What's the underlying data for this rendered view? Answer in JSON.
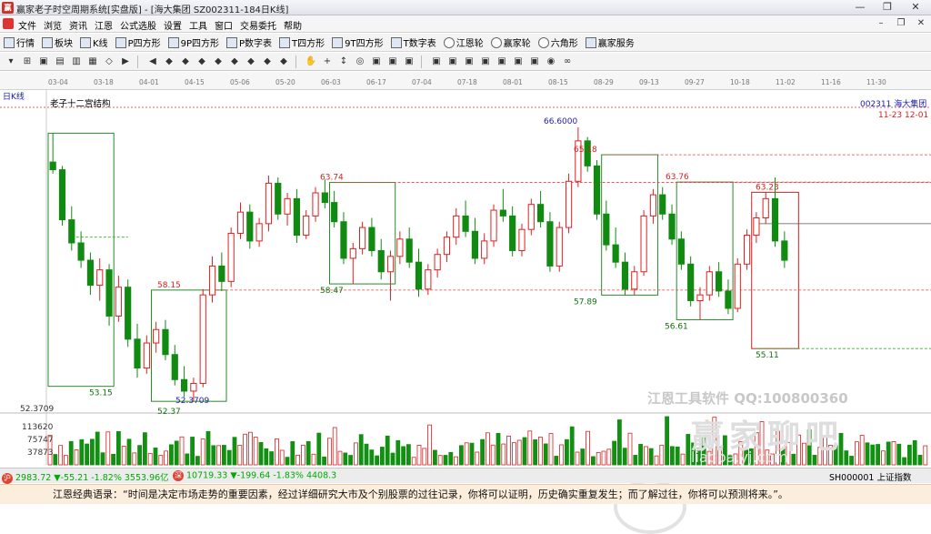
{
  "window": {
    "title": "赢家老子时空周期系统[实盘版] - [海大集团  SZ002311-184日K线]",
    "min": "—",
    "max": "❐",
    "close": "✕"
  },
  "menu": [
    "文件",
    "浏览",
    "资讯",
    "江恩",
    "公式选股",
    "设置",
    "工具",
    "窗口",
    "交易委托",
    "帮助"
  ],
  "toolbar1": [
    {
      "label": "行情",
      "icon": "grid-icon"
    },
    {
      "label": "板块",
      "icon": "blocks-icon"
    },
    {
      "label": "K线",
      "icon": "kline-icon"
    },
    {
      "label": "P四方形",
      "icon": "square-icon"
    },
    {
      "label": "9P四方形",
      "icon": "square-icon"
    },
    {
      "label": "P数字表",
      "icon": "table-icon"
    },
    {
      "label": "T四方形",
      "icon": "square-icon"
    },
    {
      "label": "9T四方形",
      "icon": "square-icon"
    },
    {
      "label": "T数字表",
      "icon": "table-icon"
    },
    {
      "label": "江恩轮",
      "icon": "wheel-icon"
    },
    {
      "label": "赢家轮",
      "icon": "wheel-icon"
    },
    {
      "label": "六角形",
      "icon": "hexagon-icon"
    },
    {
      "label": "赢家服务",
      "icon": "dollar-icon"
    }
  ],
  "toolbar2": [
    "▾",
    "⊞",
    "▣",
    "▤",
    "▥",
    "▦",
    "◇",
    "▶",
    "◀",
    "◆",
    "◆",
    "◆",
    "◆",
    "◆",
    "◆",
    "◆",
    "◆",
    "✋",
    "+",
    "↕",
    "◎",
    "▣",
    "▣",
    "▣",
    "▣",
    "▣",
    "▣",
    "▣",
    "▣",
    "▣",
    "▣",
    "◉",
    "∞"
  ],
  "chart": {
    "period_label": "日K线",
    "structure_label": "老子十二宫结构",
    "stock_label": "002311 海大集团",
    "date_range": "11-23  12-01",
    "x_dates": [
      "03-04",
      "03-18",
      "04-01",
      "04-15",
      "05-06",
      "05-20",
      "06-03",
      "06-17",
      "07-04",
      "07-18",
      "08-01",
      "08-15",
      "08-29",
      "09-13",
      "09-27",
      "10-18",
      "11-02",
      "11-16",
      "11-30"
    ],
    "min_price_label": "52.3709",
    "vol_labels": [
      "113620",
      "75747",
      "37873"
    ],
    "price_labels": [
      {
        "text": "66.6000",
        "color": "#2222aa"
      },
      {
        "text": "65.18",
        "color": "#d02020"
      },
      {
        "text": "63.74",
        "color": "#d02020"
      },
      {
        "text": "63.76",
        "color": "#d02020"
      },
      {
        "text": "63.23",
        "color": "#d02020"
      },
      {
        "text": "58.15",
        "color": "#d02020"
      },
      {
        "text": "58.47",
        "color": "#107010"
      },
      {
        "text": "57.89",
        "color": "#107010"
      },
      {
        "text": "56.61",
        "color": "#107010"
      },
      {
        "text": "55.11",
        "color": "#107010"
      },
      {
        "text": "53.15",
        "color": "#107010"
      },
      {
        "text": "52.37",
        "color": "#107010"
      },
      {
        "text": "52.3709",
        "color": "#2222aa"
      }
    ]
  },
  "chart_data": {
    "type": "candlestick",
    "title": "海大集团 002311 日K线",
    "ylim": [
      52.0,
      67.5
    ],
    "series": [
      {
        "name": "海大集团",
        "values": [
          [
            64.8,
            66.3,
            64.2,
            64.4
          ],
          [
            64.4,
            64.6,
            61.5,
            61.8
          ],
          [
            61.8,
            62.5,
            60.2,
            60.6
          ],
          [
            60.6,
            61.2,
            59.3,
            59.7
          ],
          [
            59.7,
            60.1,
            57.9,
            58.4
          ],
          [
            58.4,
            59.8,
            57.6,
            59.2
          ],
          [
            59.2,
            59.5,
            56.3,
            56.8
          ],
          [
            56.8,
            58.9,
            56.5,
            58.3
          ],
          [
            58.3,
            58.7,
            55.2,
            55.6
          ],
          [
            55.6,
            56.4,
            53.6,
            54.1
          ],
          [
            54.1,
            55.8,
            53.8,
            55.4
          ],
          [
            55.4,
            56.5,
            54.9,
            56.1
          ],
          [
            56.1,
            56.6,
            54.5,
            54.8
          ],
          [
            54.8,
            55.3,
            53.2,
            53.5
          ],
          [
            53.5,
            54.2,
            52.6,
            52.9
          ],
          [
            52.9,
            53.6,
            52.37,
            53.3
          ],
          [
            53.3,
            58.2,
            53.1,
            57.9
          ],
          [
            57.9,
            59.9,
            57.5,
            59.4
          ],
          [
            59.4,
            60.1,
            58.1,
            58.6
          ],
          [
            58.6,
            61.4,
            58.3,
            61.1
          ],
          [
            61.1,
            62.7,
            60.8,
            62.2
          ],
          [
            62.2,
            62.6,
            60.3,
            60.7
          ],
          [
            60.7,
            61.9,
            60.4,
            61.6
          ],
          [
            61.6,
            64.1,
            61.2,
            63.7
          ],
          [
            63.7,
            64.0,
            61.8,
            62.1
          ],
          [
            62.1,
            63.2,
            61.5,
            62.9
          ],
          [
            62.9,
            63.4,
            60.6,
            61.0
          ],
          [
            61.0,
            62.3,
            60.8,
            62.0
          ],
          [
            62.0,
            63.5,
            61.7,
            63.2
          ],
          [
            63.2,
            63.9,
            62.4,
            62.7
          ],
          [
            62.7,
            63.3,
            61.4,
            61.7
          ],
          [
            61.7,
            62.2,
            59.5,
            59.8
          ],
          [
            59.8,
            60.6,
            58.47,
            60.3
          ],
          [
            60.3,
            61.7,
            60.0,
            61.4
          ],
          [
            61.4,
            61.9,
            59.9,
            60.2
          ],
          [
            60.2,
            60.8,
            58.7,
            59.1
          ],
          [
            59.1,
            60.2,
            57.6,
            59.9
          ],
          [
            59.9,
            61.2,
            59.5,
            60.8
          ],
          [
            60.8,
            61.4,
            59.3,
            59.6
          ],
          [
            59.6,
            60.3,
            57.8,
            58.2
          ],
          [
            58.2,
            59.5,
            57.9,
            59.2
          ],
          [
            59.2,
            60.3,
            58.8,
            60.0
          ],
          [
            60.0,
            61.2,
            59.6,
            60.9
          ],
          [
            60.9,
            62.4,
            60.5,
            62.0
          ],
          [
            62.0,
            62.8,
            60.9,
            61.2
          ],
          [
            61.2,
            61.9,
            59.5,
            59.8
          ],
          [
            59.8,
            61.1,
            59.5,
            60.7
          ],
          [
            60.7,
            62.6,
            60.4,
            62.3
          ],
          [
            62.3,
            63.4,
            61.7,
            62.0
          ],
          [
            62.0,
            62.5,
            59.9,
            60.2
          ],
          [
            60.2,
            61.6,
            59.9,
            61.3
          ],
          [
            61.3,
            62.9,
            61.0,
            62.6
          ],
          [
            62.6,
            63.3,
            61.4,
            61.7
          ],
          [
            61.7,
            62.2,
            59.1,
            59.4
          ],
          [
            59.4,
            61.7,
            59.1,
            61.4
          ],
          [
            61.4,
            64.2,
            61.1,
            63.8
          ],
          [
            63.8,
            66.6,
            63.5,
            65.9
          ],
          [
            65.9,
            66.1,
            64.3,
            64.6
          ],
          [
            64.6,
            64.9,
            61.8,
            62.1
          ],
          [
            62.1,
            62.8,
            60.2,
            60.5
          ],
          [
            60.5,
            61.4,
            59.3,
            59.6
          ],
          [
            59.6,
            60.1,
            57.9,
            58.2
          ],
          [
            58.2,
            59.4,
            57.89,
            59.1
          ],
          [
            59.1,
            62.3,
            58.9,
            62.0
          ],
          [
            62.0,
            63.4,
            61.6,
            63.1
          ],
          [
            63.1,
            63.5,
            61.8,
            62.1
          ],
          [
            62.1,
            62.6,
            60.5,
            60.8
          ],
          [
            60.8,
            61.2,
            59.2,
            59.5
          ],
          [
            59.5,
            59.9,
            57.3,
            57.6
          ],
          [
            57.6,
            58.3,
            56.61,
            57.9
          ],
          [
            57.9,
            59.4,
            57.6,
            59.1
          ],
          [
            59.1,
            59.6,
            57.8,
            58.1
          ],
          [
            58.1,
            58.7,
            56.9,
            57.2
          ],
          [
            57.2,
            59.8,
            57.0,
            59.5
          ],
          [
            59.5,
            61.3,
            59.2,
            61.0
          ],
          [
            61.0,
            62.2,
            60.6,
            61.9
          ],
          [
            61.9,
            63.23,
            61.6,
            62.9
          ],
          [
            62.9,
            64.0,
            60.4,
            60.7
          ],
          [
            60.7,
            61.2,
            59.3,
            59.7
          ]
        ]
      }
    ],
    "volume": {
      "ticks": [
        37873,
        75747,
        113620
      ]
    }
  },
  "statusbar": {
    "sh_icon": "沪",
    "sh": "2983.72 ▼-55.21 -1.82% 3553.96亿",
    "sz_icon": "深",
    "sz": "10719.33 ▼-199.64 -1.83% 4408.3",
    "right": "SH000001 上证指数"
  },
  "quote": "江恩经典语录：“时间是决定市场走势的重要因素，经过详细研究大市及个别股票的过往记录，你将可以证明，历史确实重复发生；而了解过往，你将可以预测将来。”。",
  "watermark": {
    "line1": "江恩工具软件  QQ:100800360",
    "line2": "赢家聊吧",
    "line3": "liaoba.yj.com"
  }
}
